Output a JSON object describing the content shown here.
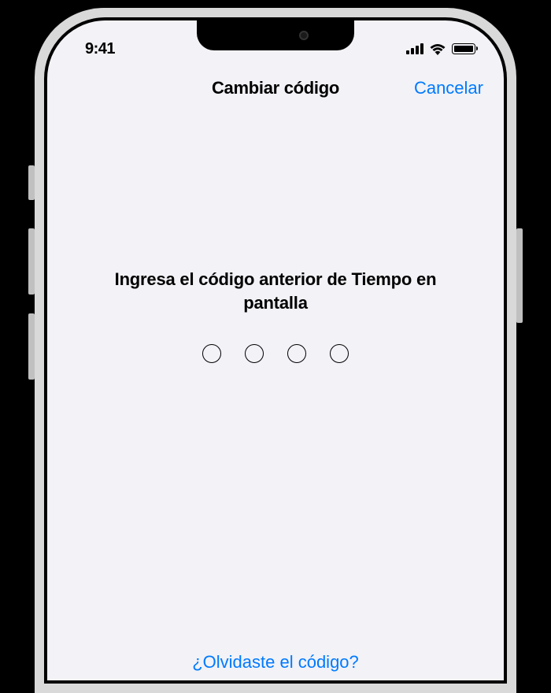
{
  "statusBar": {
    "time": "9:41"
  },
  "navBar": {
    "title": "Cambiar código",
    "cancel": "Cancelar"
  },
  "content": {
    "prompt": "Ingresa el código anterior de Tiempo en pantalla",
    "passcodeDigits": 4
  },
  "footer": {
    "forgotLink": "¿Olvidaste el código?"
  },
  "colors": {
    "accent": "#007aff",
    "background": "#f2f2f7"
  }
}
